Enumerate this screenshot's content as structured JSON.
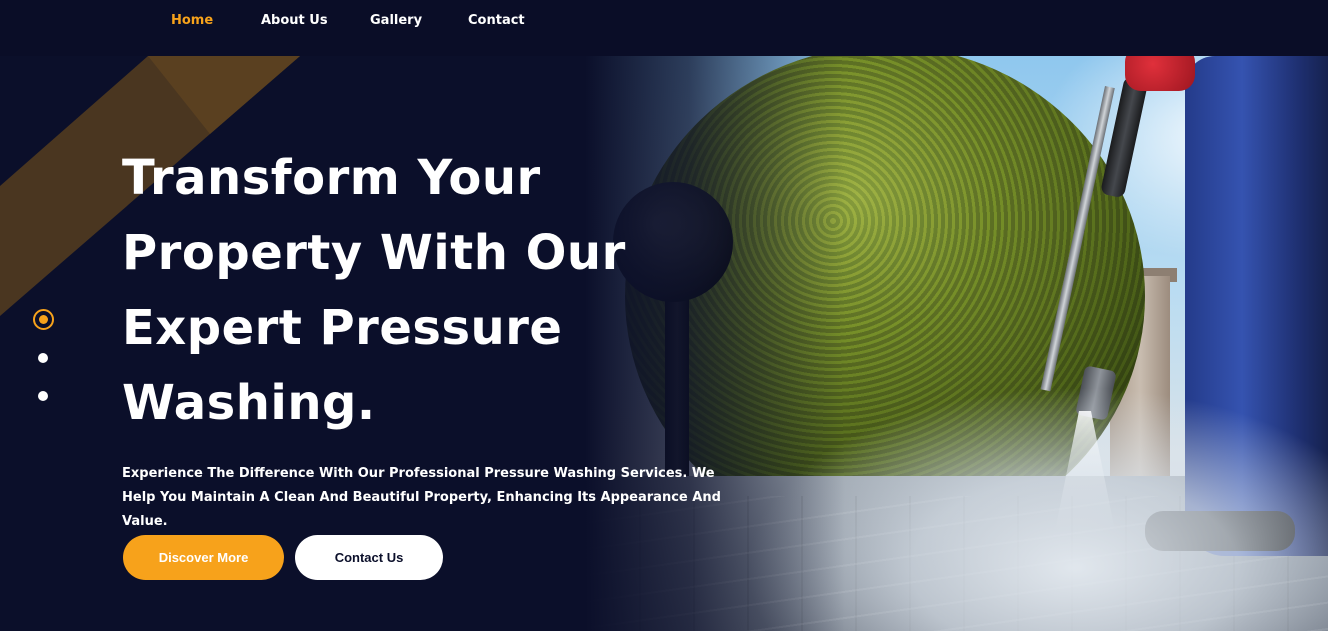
{
  "nav": {
    "items": [
      {
        "label": "Home",
        "active": true
      },
      {
        "label": "About Us",
        "active": false
      },
      {
        "label": "Gallery",
        "active": false
      },
      {
        "label": "Contact",
        "active": false
      }
    ]
  },
  "hero": {
    "headline": "Transform Your Property With Our Expert Pressure Washing.",
    "subtext": "Experience The Difference With Our Professional Pressure Washing Services. We Help You Maintain A Clean And Beautiful Property, Enhancing Its Appearance And Value.",
    "primary_button": "Discover More",
    "secondary_button": "Contact Us",
    "slider": {
      "count": 3,
      "active_index": 0
    }
  },
  "colors": {
    "accent": "#f7a21b",
    "background": "#0b0f2a",
    "nav_background": "#0a0d27"
  }
}
